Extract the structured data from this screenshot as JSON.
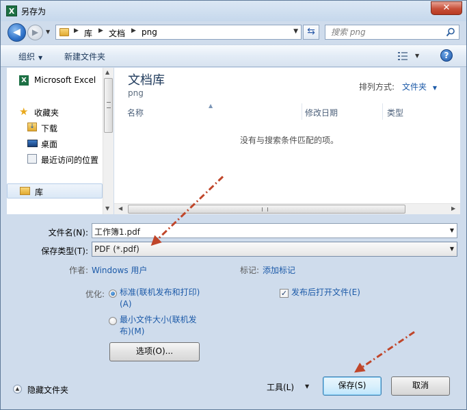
{
  "window": {
    "title": "另存为",
    "app_icon": "excel-icon",
    "close_label": "✕"
  },
  "address": {
    "crumbs": [
      "库",
      "文档",
      "png"
    ],
    "search_placeholder": "搜索 png"
  },
  "toolbar": {
    "organize_label": "组织",
    "new_folder_label": "新建文件夹",
    "help_label": "?"
  },
  "nav_pane": {
    "items": [
      {
        "label": "Microsoft Excel",
        "icon": "excel-icon"
      },
      {
        "label": "收藏夹",
        "icon": "star-icon"
      },
      {
        "label": "下载",
        "icon": "download-folder-icon"
      },
      {
        "label": "桌面",
        "icon": "desktop-icon"
      },
      {
        "label": "最近访问的位置",
        "icon": "recent-places-icon"
      },
      {
        "label": "库",
        "icon": "library-icon"
      }
    ]
  },
  "content": {
    "library_title": "文档库",
    "library_subtitle": "png",
    "arrange_label": "排列方式:",
    "arrange_value": "文件夹",
    "columns": [
      "名称",
      "修改日期",
      "类型"
    ],
    "empty_message": "没有与搜索条件匹配的项。"
  },
  "form": {
    "filename_label": "文件名(N):",
    "filename_value": "工作簿1.pdf",
    "savetype_label": "保存类型(T):",
    "savetype_value": "PDF (*.pdf)",
    "author_label": "作者:",
    "author_value": "Windows 用户",
    "tags_label": "标记:",
    "tags_value": "添加标记",
    "optimize_label": "优化:",
    "option_standard_line1": "标准(联机发布和打印)",
    "option_standard_line2": "(A)",
    "option_standard_checked": true,
    "option_min_line1": "最小文件大小(联机发",
    "option_min_line2": "布)(M)",
    "option_min_checked": false,
    "open_after_publish_label": "发布后打开文件(E)",
    "open_after_publish_checked": true,
    "options_button": "选项(O)..."
  },
  "footer": {
    "hide_folders_label": "隐藏文件夹",
    "tools_label": "工具(L)",
    "save_button": "保存(S)",
    "cancel_button": "取消"
  },
  "colors": {
    "annotation_arrow": "#c0462a",
    "link_blue": "#1c5aa8",
    "title_bar": "#cfdcec"
  }
}
